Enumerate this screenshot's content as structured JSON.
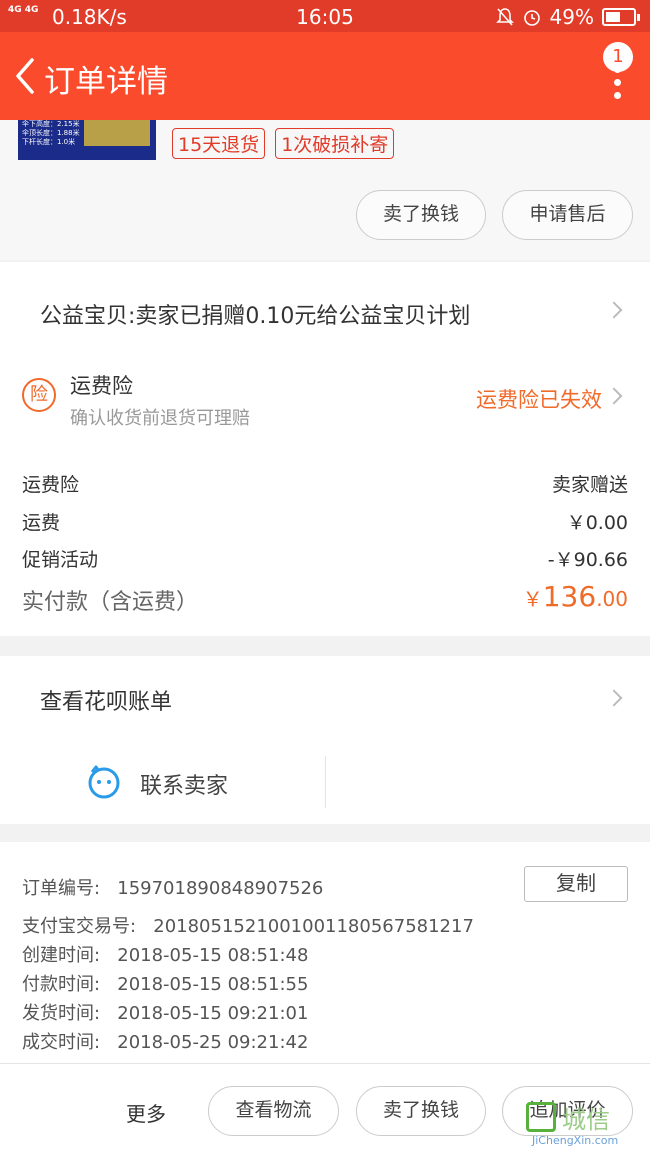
{
  "status_bar": {
    "signal": "4G 4G",
    "speed": "0.18K/s",
    "time": "16:05",
    "battery": "49%"
  },
  "navbar": {
    "title": "订单详情",
    "badge": "1"
  },
  "product": {
    "thumb_lines": [
      "伞下高度：2.15米",
      "伞顶长度：1.88米",
      "下杆长度：1.0米"
    ],
    "tags": [
      "15天退货",
      "1次破损补寄"
    ],
    "buttons": [
      "卖了换钱",
      "申请售后"
    ]
  },
  "charity": {
    "text": "公益宝贝:卖家已捐赠0.10元给公益宝贝计划"
  },
  "insurance": {
    "icon_text": "险",
    "title": "运费险",
    "subtitle": "确认收货前退货可理赔",
    "status": "运费险已失效"
  },
  "fees": [
    {
      "label": "运费险",
      "value": "卖家赠送"
    },
    {
      "label": "运费",
      "value": "￥0.00"
    },
    {
      "label": "促销活动",
      "value": "-￥90.66"
    }
  ],
  "paid": {
    "label": "实付款（含运费）",
    "currency": "￥",
    "integer": "136",
    "decimal": ".00"
  },
  "huabei": {
    "text": "查看花呗账单"
  },
  "contact": {
    "label": "联系卖家"
  },
  "order_info": {
    "copy_label": "复制",
    "rows": [
      {
        "label": "订单编号:",
        "value": "159701890848907526"
      },
      {
        "label": "支付宝交易号:",
        "value": "2018051521001001180567581217"
      },
      {
        "label": "创建时间:",
        "value": "2018-05-15 08:51:48"
      },
      {
        "label": "付款时间:",
        "value": "2018-05-15 08:51:55"
      },
      {
        "label": "发货时间:",
        "value": "2018-05-15 09:21:01"
      },
      {
        "label": "成交时间:",
        "value": "2018-05-25 09:21:42"
      }
    ]
  },
  "bottom_bar": {
    "more": "更多",
    "buttons": [
      "查看物流",
      "卖了换钱",
      "追加评价"
    ]
  },
  "watermark": {
    "text": "城信",
    "sub": "JiChengXin.com"
  },
  "colors": {
    "accent": "#fa4b2c",
    "statusbar": "#e13b2a",
    "orange": "#f06a2a"
  }
}
